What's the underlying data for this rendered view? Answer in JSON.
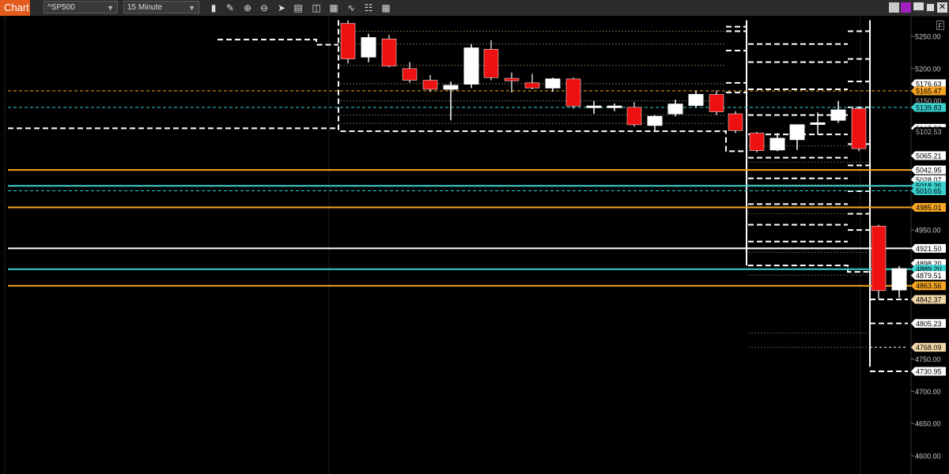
{
  "toolbar": {
    "app_title": "Chart",
    "symbol": "^SP500",
    "interval": "15 Minute",
    "tools": [
      "bar-chart-icon",
      "pencil-icon",
      "zoom-in-icon",
      "zoom-out-icon",
      "cursor-icon",
      "document-icon",
      "split-icon",
      "layout-icon",
      "indicator-icon",
      "grid-icon"
    ],
    "window_buttons": [
      "restore-icon",
      "color-icon",
      "minimize-icon",
      "maximize-icon",
      "close-icon"
    ]
  },
  "edge_label": "F",
  "colors": {
    "up": "#ffffff",
    "down": "#ee1111",
    "orange": "#f5a623",
    "cyan": "#3ad0d0",
    "white": "#ffffff",
    "background": "#000000"
  },
  "chart_data": {
    "type": "candlestick",
    "ylim": [
      4580,
      5275
    ],
    "y_ticks": [
      5250,
      5200,
      4950,
      4750,
      4700,
      4650,
      4600
    ],
    "y_tick_labels": [
      "5250.00",
      "5200.00",
      "4950.00",
      "4750.00",
      "4700.00",
      "4650.00",
      "4600.00"
    ],
    "candles": [
      {
        "x": 440,
        "o": 5270,
        "h": 5275,
        "l": 5208,
        "c": 5215
      },
      {
        "x": 466,
        "o": 5218,
        "h": 5254,
        "l": 5210,
        "c": 5248
      },
      {
        "x": 492,
        "o": 5246,
        "h": 5252,
        "l": 5202,
        "c": 5204
      },
      {
        "x": 518,
        "o": 5200,
        "h": 5210,
        "l": 5178,
        "c": 5182
      },
      {
        "x": 544,
        "o": 5182,
        "h": 5190,
        "l": 5164,
        "c": 5168
      },
      {
        "x": 570,
        "o": 5168,
        "h": 5180,
        "l": 5120,
        "c": 5174
      },
      {
        "x": 596,
        "o": 5176,
        "h": 5238,
        "l": 5170,
        "c": 5232
      },
      {
        "x": 621,
        "o": 5230,
        "h": 5244,
        "l": 5182,
        "c": 5186
      },
      {
        "x": 647,
        "o": 5185,
        "h": 5194,
        "l": 5163,
        "c": 5181
      },
      {
        "x": 673,
        "o": 5178,
        "h": 5192,
        "l": 5168,
        "c": 5170
      },
      {
        "x": 699,
        "o": 5170,
        "h": 5186,
        "l": 5164,
        "c": 5184
      },
      {
        "x": 725,
        "o": 5184,
        "h": 5186,
        "l": 5138,
        "c": 5142
      },
      {
        "x": 751,
        "o": 5141,
        "h": 5150,
        "l": 5130,
        "c": 5142
      },
      {
        "x": 777,
        "o": 5141,
        "h": 5146,
        "l": 5134,
        "c": 5142
      },
      {
        "x": 802,
        "o": 5140,
        "h": 5148,
        "l": 5110,
        "c": 5113
      },
      {
        "x": 828,
        "o": 5112,
        "h": 5128,
        "l": 5104,
        "c": 5126
      },
      {
        "x": 854,
        "o": 5130,
        "h": 5152,
        "l": 5126,
        "c": 5145
      },
      {
        "x": 880,
        "o": 5143,
        "h": 5166,
        "l": 5140,
        "c": 5160
      },
      {
        "x": 906,
        "o": 5160,
        "h": 5166,
        "l": 5128,
        "c": 5133
      },
      {
        "x": 930,
        "o": 5130,
        "h": 5134,
        "l": 5100,
        "c": 5104
      },
      {
        "x": 957,
        "o": 5100,
        "h": 5102,
        "l": 5070,
        "c": 5073
      },
      {
        "x": 983,
        "o": 5074,
        "h": 5100,
        "l": 5072,
        "c": 5092
      },
      {
        "x": 1008,
        "o": 5090,
        "h": 5112,
        "l": 5074,
        "c": 5113
      },
      {
        "x": 1034,
        "o": 5116,
        "h": 5132,
        "l": 5098,
        "c": 5116
      },
      {
        "x": 1060,
        "o": 5120,
        "h": 5150,
        "l": 5116,
        "c": 5136
      },
      {
        "x": 1086,
        "o": 5138,
        "h": 5140,
        "l": 5072,
        "c": 5076
      },
      {
        "x": 1111,
        "o": 4956,
        "h": 4958,
        "l": 4843,
        "c": 4856
      },
      {
        "x": 1137,
        "o": 4857,
        "h": 4894,
        "l": 4845,
        "c": 4890
      }
    ],
    "right_labels": [
      {
        "v": 5176.63,
        "text": "5176.63",
        "style": "white"
      },
      {
        "v": 5165.47,
        "text": "5165.47",
        "style": "orange"
      },
      {
        "v": 5150.0,
        "text": "5150.00",
        "style": "dim"
      },
      {
        "v": 5139.83,
        "text": "5139.83",
        "style": "cyan"
      },
      {
        "v": 5107.53,
        "text": "5107.53",
        "style": "white"
      },
      {
        "v": 5102.53,
        "text": "5102.53",
        "style": "dim"
      },
      {
        "v": 5065.21,
        "text": "5065.21",
        "style": "white"
      },
      {
        "v": 5042.95,
        "text": "5042.95",
        "style": "white"
      },
      {
        "v": 5028.07,
        "text": "5028.07",
        "style": "white"
      },
      {
        "v": 5018.36,
        "text": "5018.36",
        "style": "cyan"
      },
      {
        "v": 5010.65,
        "text": "5010.65",
        "style": "cyan"
      },
      {
        "v": 4985.01,
        "text": "4985.01",
        "style": "orange"
      },
      {
        "v": 4921.5,
        "text": "4921.50",
        "style": "white"
      },
      {
        "v": 4898.2,
        "text": "4898.20",
        "style": "white"
      },
      {
        "v": 4889.2,
        "text": "4889.20",
        "style": "cyan"
      },
      {
        "v": 4879.51,
        "text": "4879.51",
        "style": "white"
      },
      {
        "v": 4863.56,
        "text": "4863.56",
        "style": "orange"
      },
      {
        "v": 4842.37,
        "text": "4842.37",
        "style": "tan"
      },
      {
        "v": 4805.23,
        "text": "4805.23",
        "style": "white"
      },
      {
        "v": 4768.09,
        "text": "4768.09",
        "style": "tan"
      },
      {
        "v": 4730.95,
        "text": "4730.95",
        "style": "white"
      }
    ],
    "horizontal_lines": [
      {
        "v": 5165.47,
        "color": "orange",
        "dash": true,
        "from": 0
      },
      {
        "v": 5139.83,
        "color": "cyan",
        "dash": true,
        "from": 0
      },
      {
        "v": 5042.95,
        "color": "orange",
        "dash": false,
        "from": 0
      },
      {
        "v": 5018.36,
        "color": "cyan",
        "dash": false,
        "from": 0
      },
      {
        "v": 5010.65,
        "color": "cyan",
        "dash": true,
        "from": 0
      },
      {
        "v": 4985.01,
        "color": "orange",
        "dash": false,
        "from": 0
      },
      {
        "v": 4921.5,
        "color": "white",
        "dash": false,
        "from": 0
      },
      {
        "v": 4889.2,
        "color": "cyan",
        "dash": false,
        "from": 0
      },
      {
        "v": 4863.56,
        "color": "orange",
        "dash": false,
        "from": 0
      }
    ]
  }
}
